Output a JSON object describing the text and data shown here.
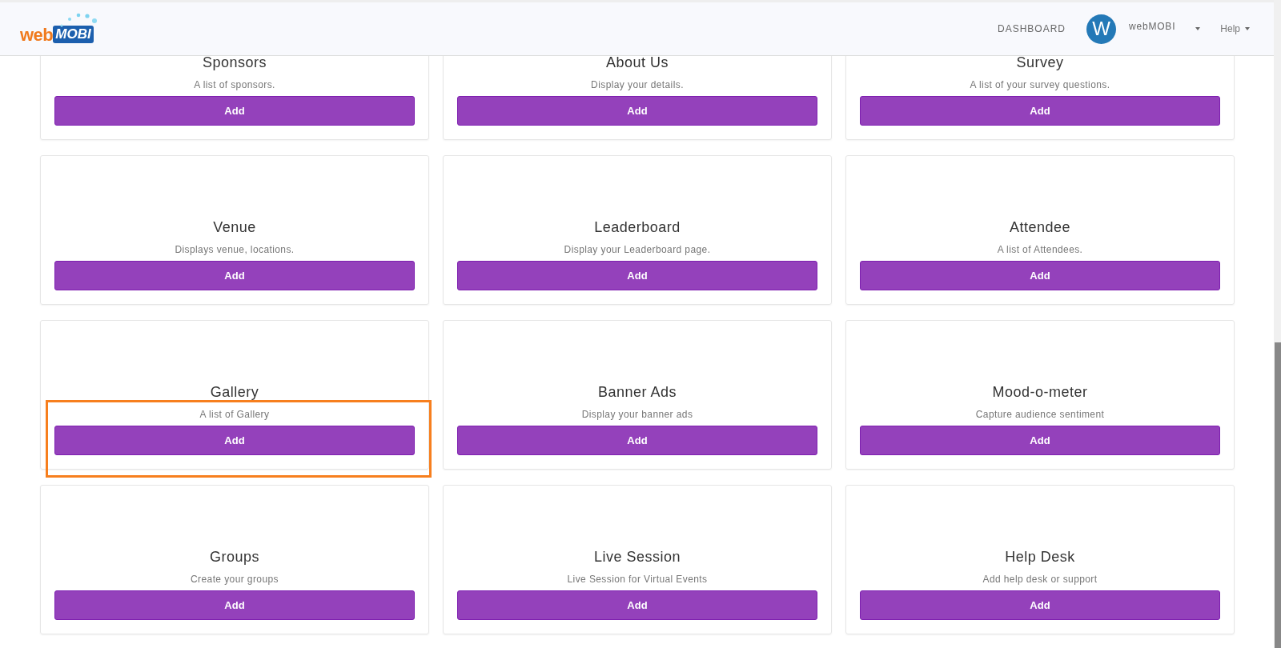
{
  "header": {
    "logo": {
      "part_1": "web",
      "part_2": "MOBI"
    },
    "nav": [
      {
        "label": "DASHBOARD"
      }
    ],
    "avatar_letter": "W",
    "user_menu": "webMOBI",
    "help_menu": "Help"
  },
  "cards": [
    {
      "title": "Sponsors",
      "description": "A list of sponsors.",
      "button": "Add",
      "highlighted": false
    },
    {
      "title": "About Us",
      "description": "Display your details.",
      "button": "Add",
      "highlighted": false
    },
    {
      "title": "Survey",
      "description": "A list of your survey questions.",
      "button": "Add",
      "highlighted": false
    },
    {
      "title": "Venue",
      "description": "Displays venue, locations.",
      "button": "Add",
      "highlighted": false
    },
    {
      "title": "Leaderboard",
      "description": "Display your Leaderboard page.",
      "button": "Add",
      "highlighted": false
    },
    {
      "title": "Attendee",
      "description": "A list of Attendees.",
      "button": "Add",
      "highlighted": false
    },
    {
      "title": "Gallery",
      "description": "A list of Gallery",
      "button": "Add",
      "highlighted": true
    },
    {
      "title": "Banner Ads",
      "description": "Display your banner ads",
      "button": "Add",
      "highlighted": false
    },
    {
      "title": "Mood-o-meter",
      "description": "Capture audience sentiment",
      "button": "Add",
      "highlighted": false
    },
    {
      "title": "Groups",
      "description": "Create your groups",
      "button": "Add",
      "highlighted": false
    },
    {
      "title": "Live Session",
      "description": "Live Session for Virtual Events",
      "button": "Add",
      "highlighted": false
    },
    {
      "title": "Help Desk",
      "description": "Add help desk or support",
      "button": "Add",
      "highlighted": false
    }
  ]
}
